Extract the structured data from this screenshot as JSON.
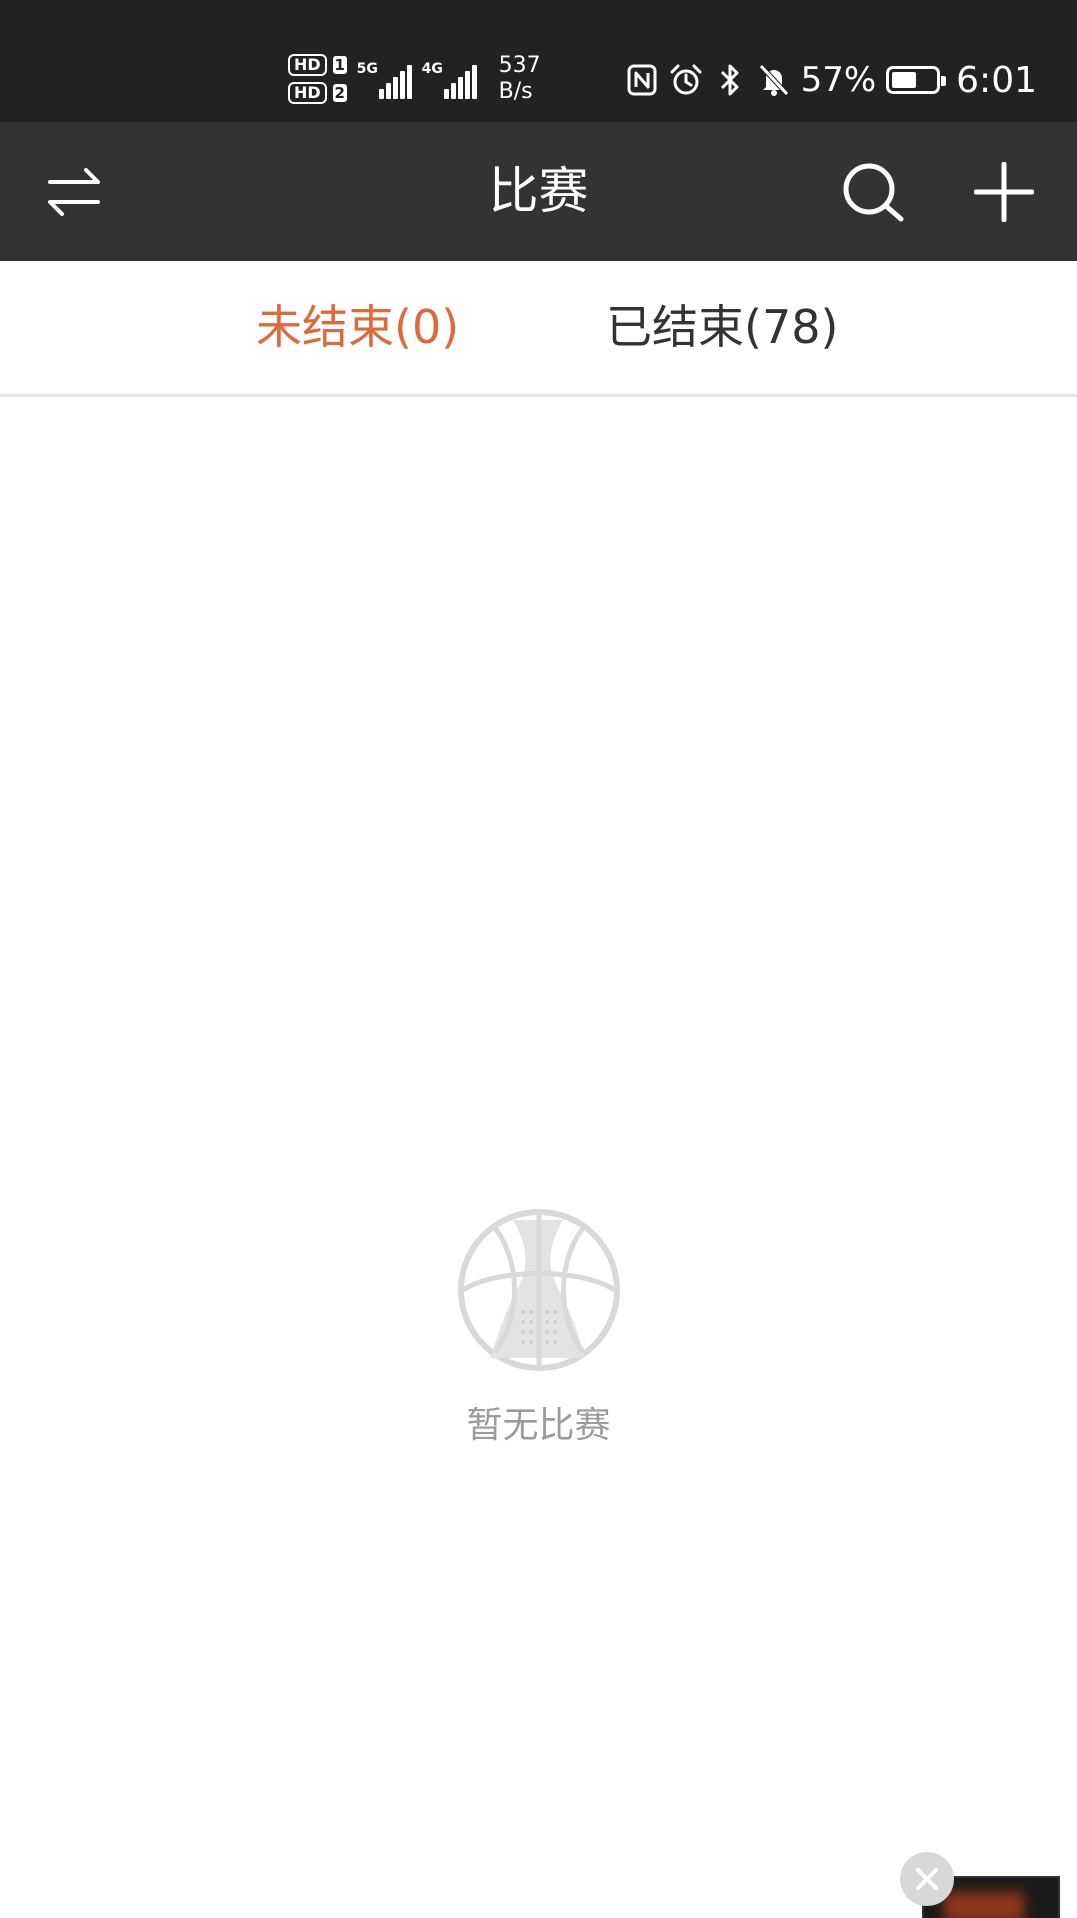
{
  "status_bar": {
    "hd1_label": "HD",
    "hd1_sim": "1",
    "hd2_label": "HD",
    "hd2_sim": "2",
    "signal1_tag": "5G",
    "signal2_tag": "4G",
    "net_speed_value": "537",
    "net_speed_unit": "B/s",
    "battery_text": "57%",
    "battery_level": 0.57,
    "time": "6:01",
    "icons": [
      "nfc-icon",
      "alarm-icon",
      "bluetooth-icon",
      "mute-bell-icon"
    ]
  },
  "app_bar": {
    "title": "比赛",
    "left_icon": "switch-arrows-icon",
    "right_icons": [
      "search-icon",
      "plus-icon"
    ]
  },
  "tabs": [
    {
      "label": "未结束(0)",
      "active": true
    },
    {
      "label": "已结束(78)",
      "active": false
    }
  ],
  "empty_state": {
    "icon": "basketball-icon",
    "message": "暂无比赛"
  },
  "colors": {
    "status_bar_bg": "#222222",
    "app_bar_bg": "#333333",
    "accent": "#E2683A",
    "tab_inactive": "#333333",
    "empty_icon": "#d9d9d9",
    "empty_text": "#9b9b9b"
  }
}
